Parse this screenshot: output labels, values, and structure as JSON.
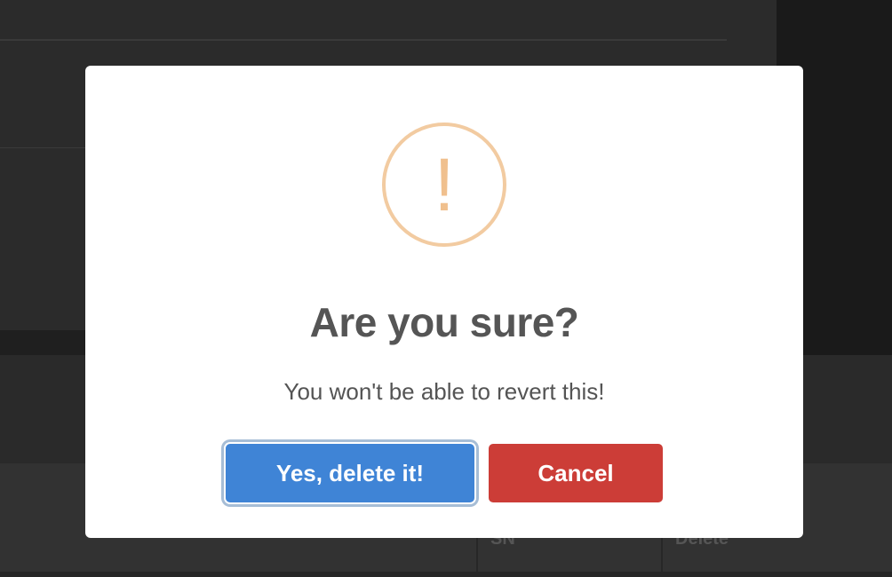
{
  "background": {
    "table_headers": [
      "SN",
      "Delete"
    ]
  },
  "dialog": {
    "icon": "warning-exclamation-icon",
    "icon_glyph": "!",
    "title": "Are you sure?",
    "text": "You won't be able to revert this!",
    "confirm_label": "Yes, delete it!",
    "cancel_label": "Cancel"
  },
  "colors": {
    "overlay_background": "#1f1f1f",
    "modal_background": "#ffffff",
    "icon_border": "#f2cba1",
    "confirm_button": "#3f84d6",
    "cancel_button": "#cc3d37",
    "title_text": "#555555"
  }
}
